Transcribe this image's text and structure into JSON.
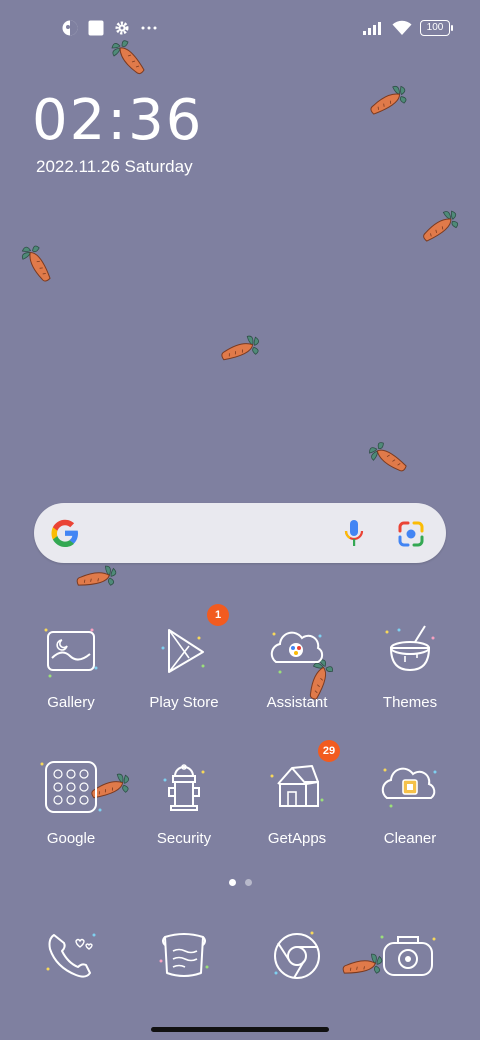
{
  "status_bar": {
    "left_icons": [
      "profile-circle-icon",
      "square-app-icon",
      "settings-gear-icon",
      "more-dots-icon"
    ],
    "right_icons": [
      "signal-bars-icon",
      "wifi-icon",
      "battery-icon"
    ],
    "battery_level": "100"
  },
  "lockscreen_widget": {
    "time": "02:36",
    "date": "2022.11.26 Saturday"
  },
  "search_widget": {
    "logo": "google-g-icon",
    "voice_icon": "microphone-icon",
    "lens_icon": "google-lens-icon"
  },
  "apps": [
    {
      "label": "Gallery",
      "icon": "gallery-icon",
      "badge": ""
    },
    {
      "label": "Play Store",
      "icon": "play-store-icon",
      "badge": "1"
    },
    {
      "label": "Assistant",
      "icon": "assistant-icon",
      "badge": ""
    },
    {
      "label": "Themes",
      "icon": "themes-icon",
      "badge": ""
    },
    {
      "label": "Google",
      "icon": "google-folder-icon",
      "badge": ""
    },
    {
      "label": "Security",
      "icon": "security-icon",
      "badge": ""
    },
    {
      "label": "GetApps",
      "icon": "getapps-icon",
      "badge": "29"
    },
    {
      "label": "Cleaner",
      "icon": "cleaner-icon",
      "badge": ""
    }
  ],
  "page_indicator": {
    "current": 1,
    "total": 2
  },
  "dock": [
    {
      "icon": "phone-icon"
    },
    {
      "icon": "messages-icon"
    },
    {
      "icon": "chrome-icon"
    },
    {
      "icon": "camera-icon"
    }
  ],
  "colors": {
    "wallpaper": "#7f80a0",
    "badge": "#f25b1f",
    "carrot": "#e07a4a",
    "leaf": "#4f8a78",
    "search_bar": "#e9e9ef"
  }
}
